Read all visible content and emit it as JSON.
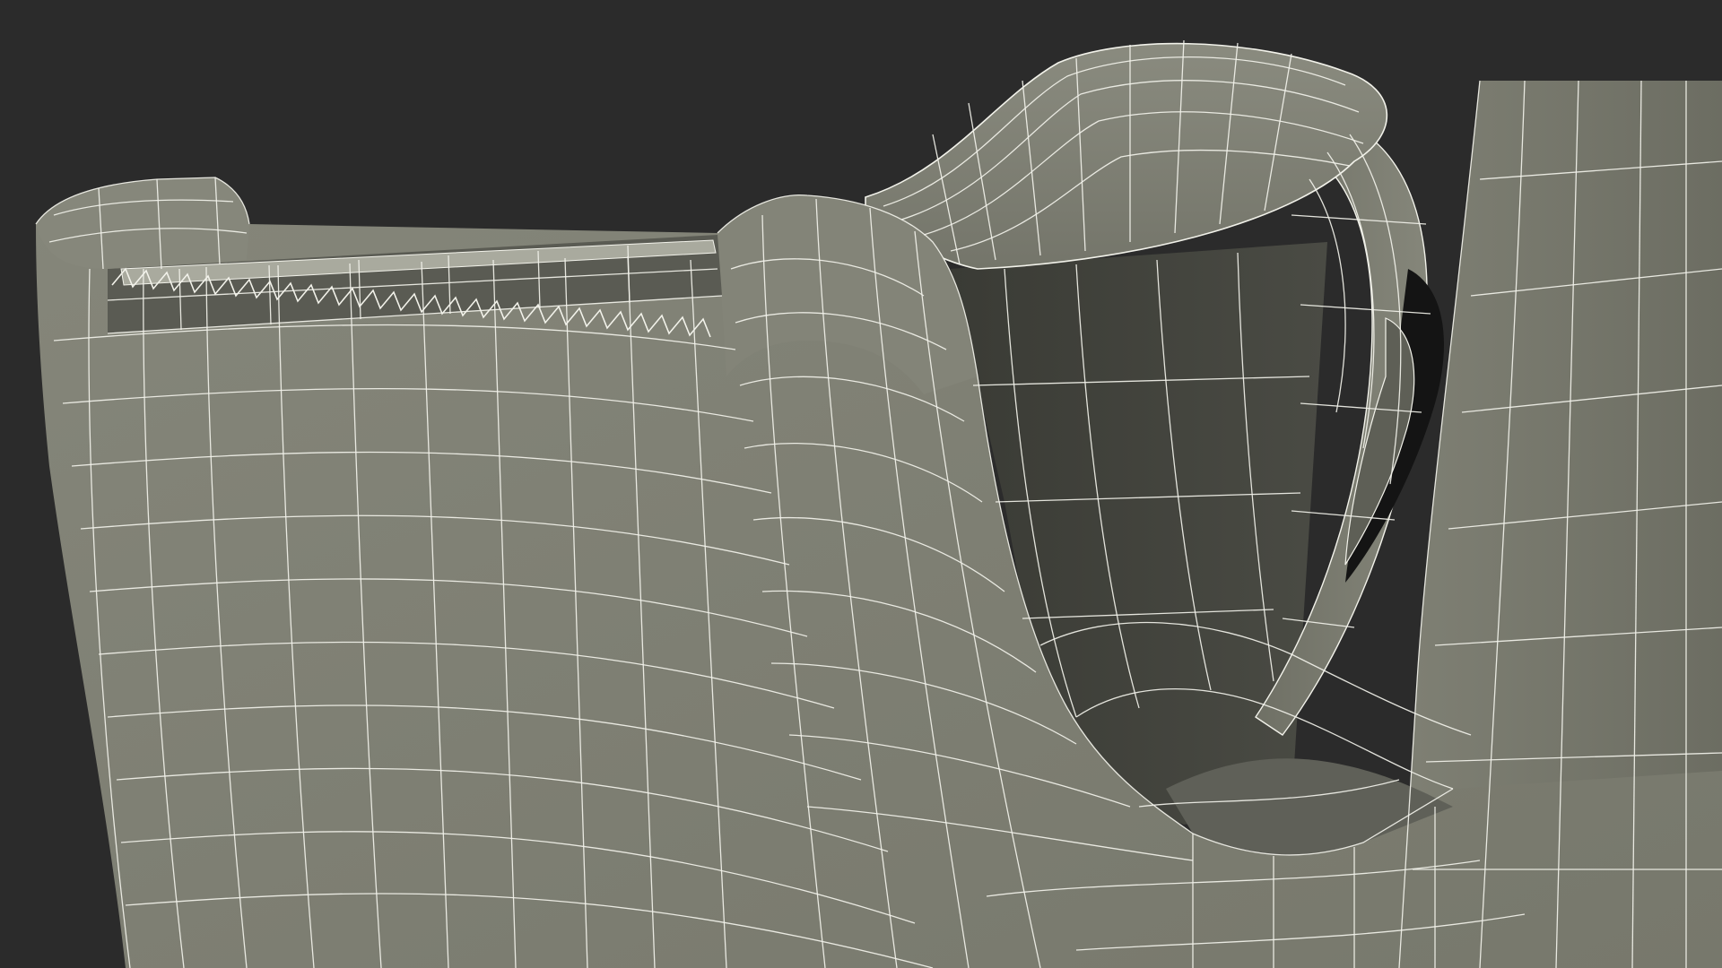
{
  "scene": {
    "subject": "tape-dispenser-wireframe",
    "colors": {
      "background": "#2b2b2b",
      "surface": "#7d7e72",
      "surface_shadow": "#5f6058",
      "surface_dark": "#45463f",
      "interior": "#3c3d37",
      "cavity": "#141414",
      "wire": "#f2f2ea"
    }
  }
}
